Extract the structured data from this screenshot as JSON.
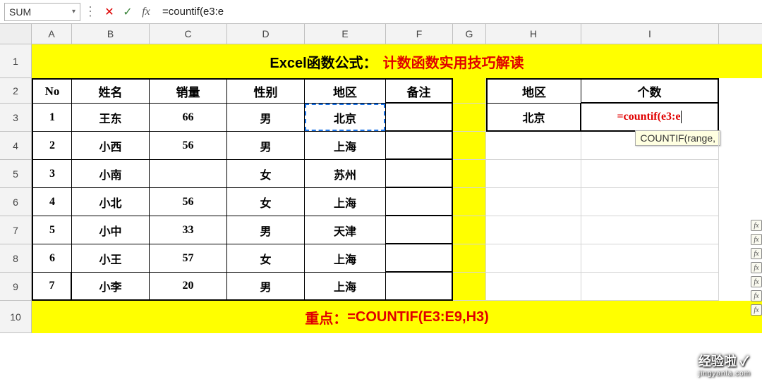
{
  "formula_bar": {
    "name_box": "SUM",
    "cancel": "✕",
    "enter": "✓",
    "fx": "fx",
    "formula": "=countif(e3:e"
  },
  "columns": [
    "A",
    "B",
    "C",
    "D",
    "E",
    "F",
    "G",
    "H",
    "I"
  ],
  "rows": [
    "1",
    "2",
    "3",
    "4",
    "5",
    "6",
    "7",
    "8",
    "9",
    "10"
  ],
  "title": {
    "prefix": "Excel函数公式：",
    "main": "计数函数实用技巧解读"
  },
  "headers": {
    "no": "No",
    "name": "姓名",
    "qty": "销量",
    "gender": "性别",
    "region": "地区",
    "note": "备注",
    "region2": "地区",
    "count": "个数"
  },
  "data": [
    {
      "no": "1",
      "name": "王东",
      "qty": "66",
      "gender": "男",
      "region": "北京"
    },
    {
      "no": "2",
      "name": "小西",
      "qty": "56",
      "gender": "男",
      "region": "上海"
    },
    {
      "no": "3",
      "name": "小南",
      "qty": "",
      "gender": "女",
      "region": "苏州"
    },
    {
      "no": "4",
      "name": "小北",
      "qty": "56",
      "gender": "女",
      "region": "上海"
    },
    {
      "no": "5",
      "name": "小中",
      "qty": "33",
      "gender": "男",
      "region": "天津"
    },
    {
      "no": "6",
      "name": "小王",
      "qty": "57",
      "gender": "女",
      "region": "上海"
    },
    {
      "no": "7",
      "name": "小李",
      "qty": "20",
      "gender": "男",
      "region": "上海"
    }
  ],
  "side": {
    "region": "北京",
    "formula": "=countif(e3:e"
  },
  "tooltip": "COUNTIF(range,",
  "bottom": {
    "label": "重点：",
    "formula": "=COUNTIF(E3:E9,H3)"
  },
  "watermark": {
    "main": "经验啦 ✓",
    "sub": "jingyanla.com"
  }
}
